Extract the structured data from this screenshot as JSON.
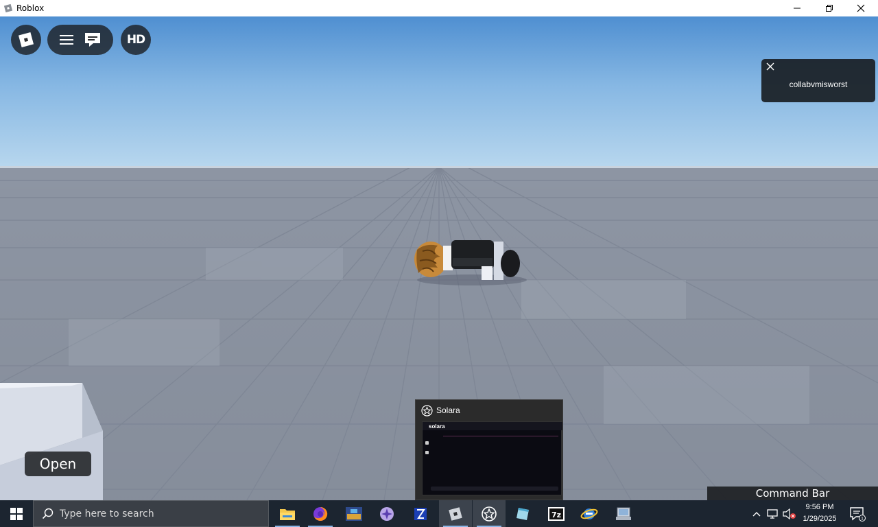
{
  "window": {
    "title": "Roblox"
  },
  "game": {
    "hd_label": "HD",
    "notification": {
      "text": "collabvmisworst"
    },
    "open_label": "Open",
    "command_bar_label": "Command Bar"
  },
  "preview": {
    "title": "Solara",
    "thumb_label": "solara"
  },
  "taskbar": {
    "search_placeholder": "Type here to search",
    "time": "9:56 PM",
    "date": "1/29/2025",
    "icons": [
      "file-explorer",
      "firefox",
      "app-3",
      "app-4",
      "app-5",
      "roblox",
      "solara",
      "app-8",
      "7zip",
      "app-10",
      "app-11"
    ]
  },
  "colors": {
    "sky_top": "#4f8fd1",
    "floor": "#8d95a3",
    "taskbar": "#1c2530"
  }
}
